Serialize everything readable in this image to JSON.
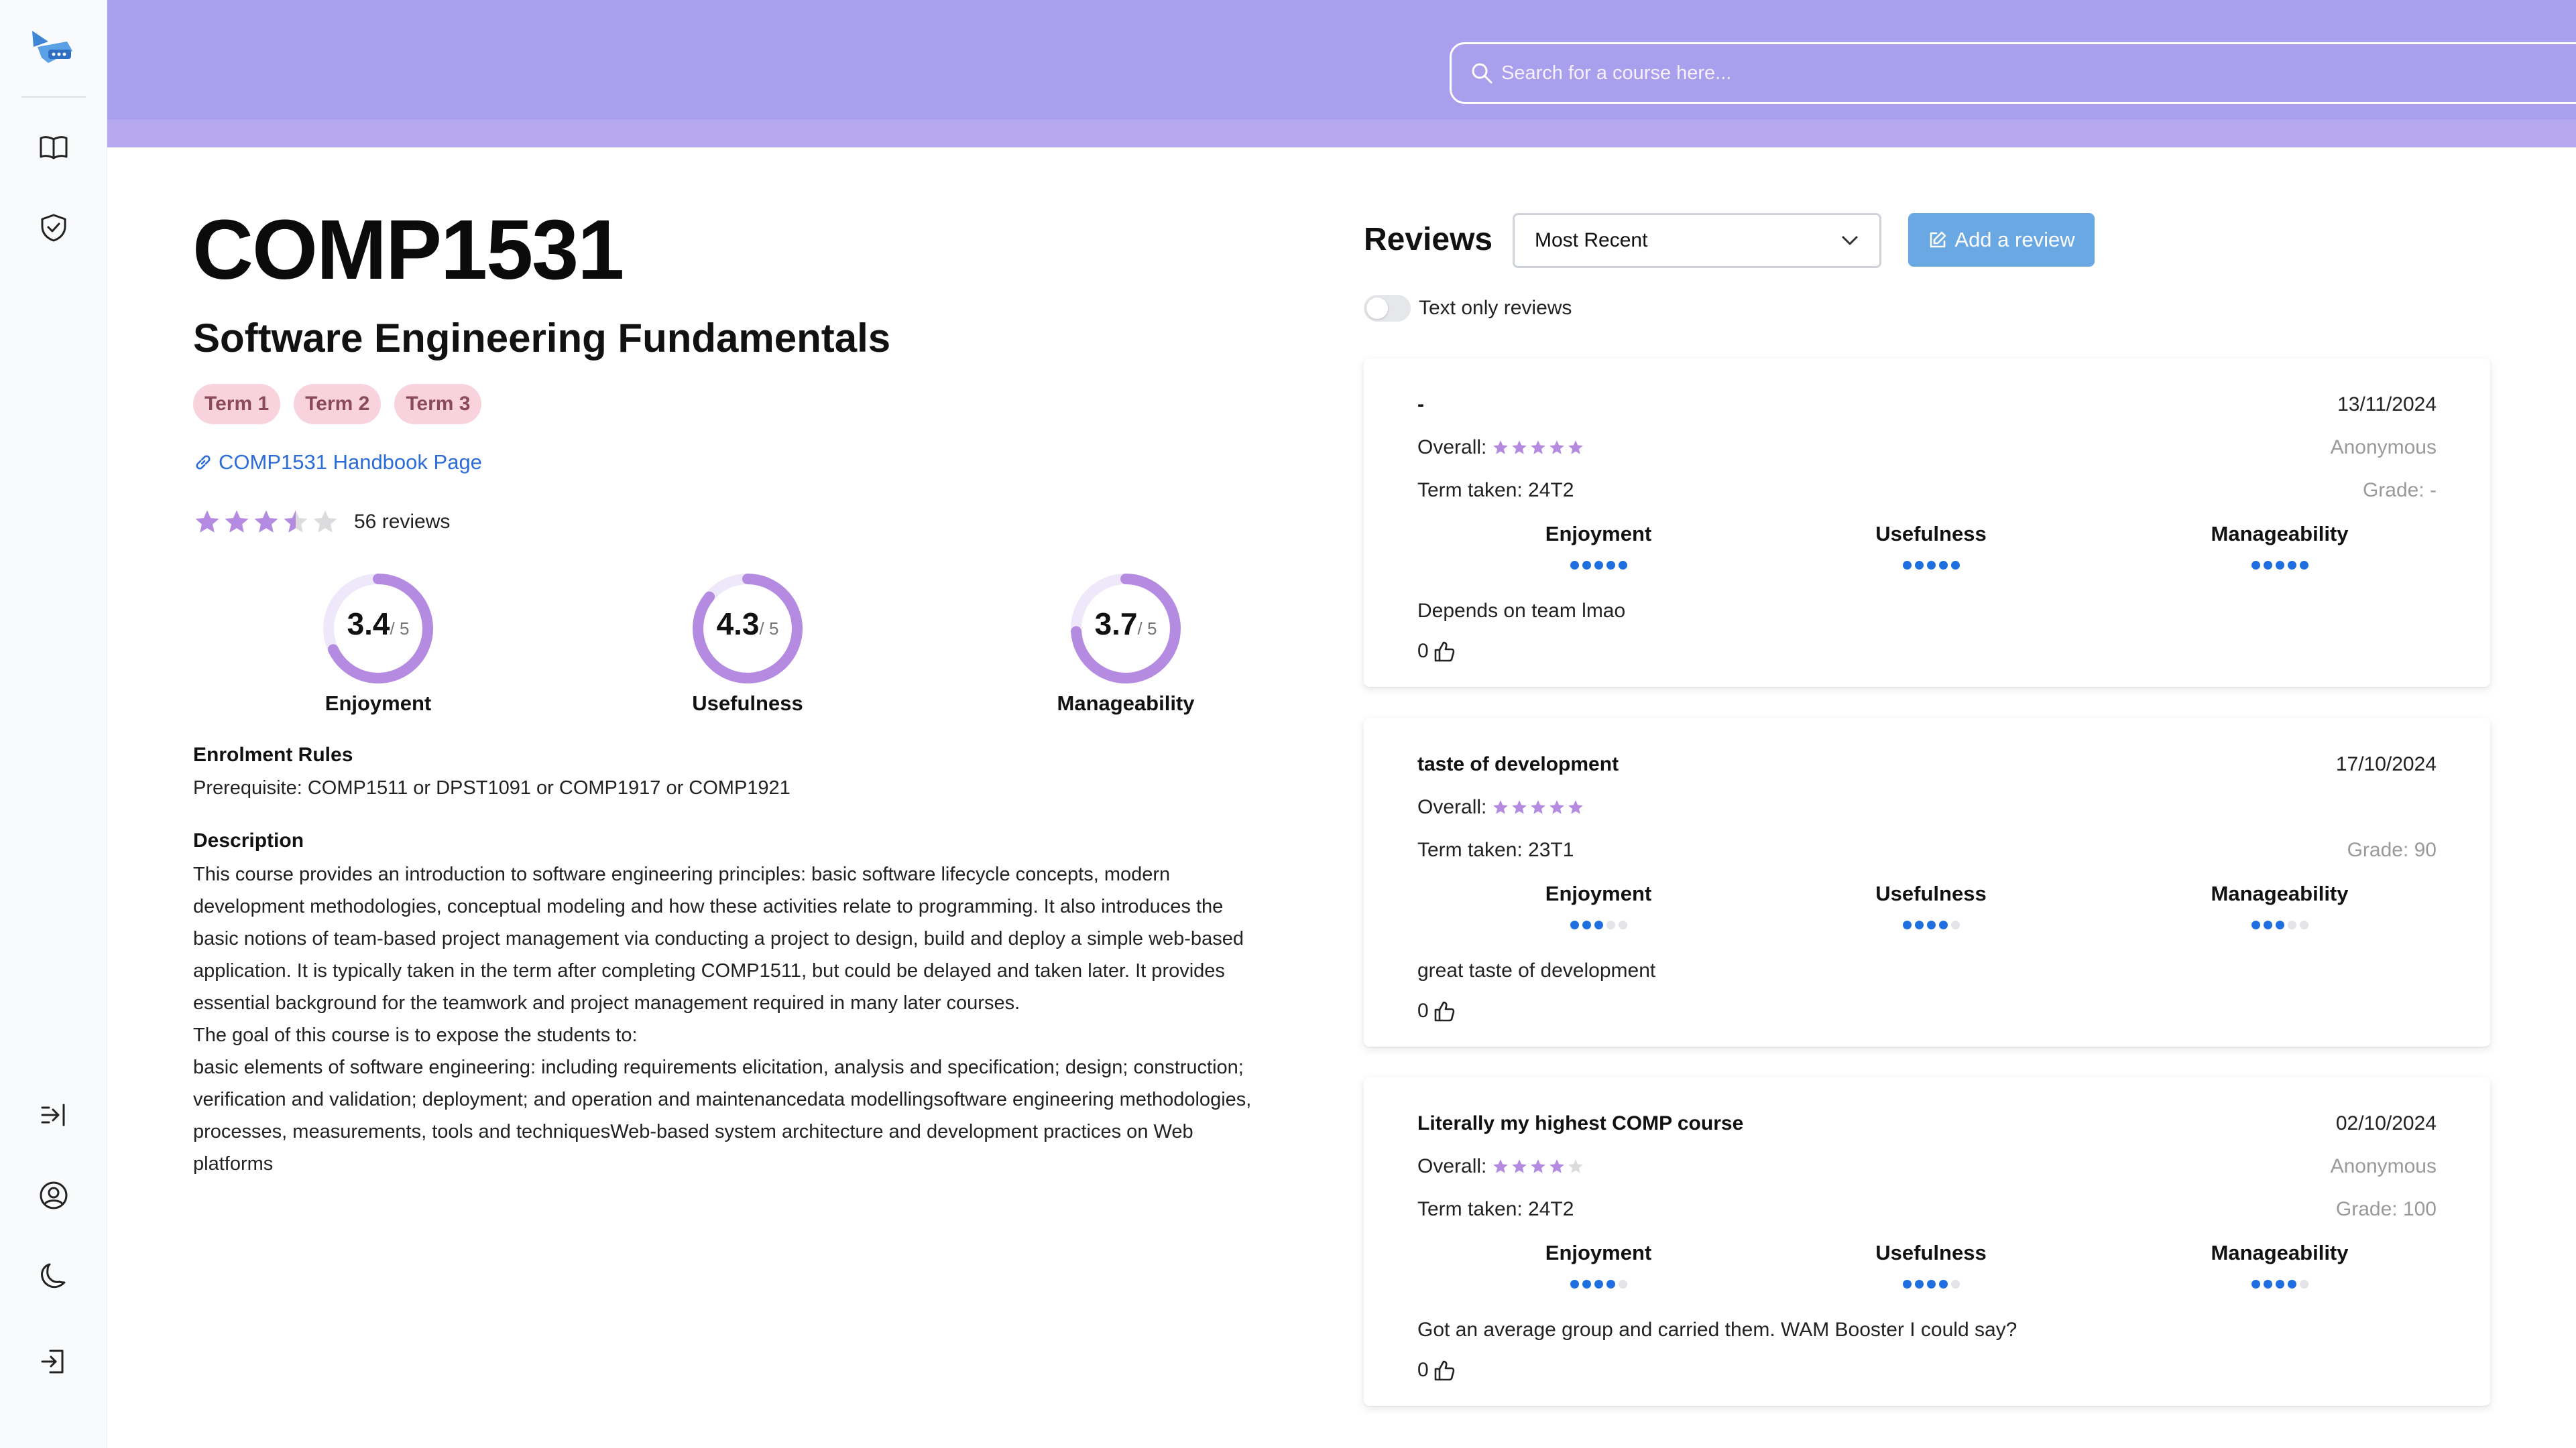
{
  "search": {
    "placeholder": "Search for a course here..."
  },
  "course": {
    "code": "COMP1531",
    "name": "Software Engineering Fundamentals",
    "terms": [
      "Term 1",
      "Term 2",
      "Term 3"
    ],
    "handbook_link": "COMP1531 Handbook Page",
    "overall_rating": 3.5,
    "overall_rating_max": 5,
    "reviews_count": "56 reviews",
    "stats": [
      {
        "value": "3.4",
        "max": "/ 5",
        "label": "Enjoyment",
        "fraction": 0.68
      },
      {
        "value": "4.3",
        "max": "/ 5",
        "label": "Usefulness",
        "fraction": 0.86
      },
      {
        "value": "3.7",
        "max": "/ 5",
        "label": "Manageability",
        "fraction": 0.74
      }
    ],
    "enrolment_title": "Enrolment Rules",
    "enrolment_text": "Prerequisite: COMP1511 or DPST1091 or COMP1917 or COMP1921",
    "description_title": "Description",
    "description_lines": [
      "This course provides an introduction to software engineering principles: basic software lifecycle concepts, modern",
      "development methodologies, conceptual modeling and how these activities relate to programming. It also introduces the",
      "basic notions of team-based project management via conducting a project to design, build and deploy a simple web-based",
      "application. It is typically taken in the term after completing COMP1511, but could be delayed and taken later. It provides",
      "essential background for the teamwork and project management required in many later courses.",
      "The goal of this course is to expose the students to:",
      "basic elements of software engineering: including requirements elicitation, analysis and specification; design; construction;",
      "verification and validation; deployment; and operation and maintenancedata modellingsoftware engineering methodologies,",
      "processes, measurements, tools and techniquesWeb-based system architecture and development practices on Web",
      "platforms"
    ]
  },
  "reviews_panel": {
    "title": "Reviews",
    "sort_selected": "Most Recent",
    "add_review_label": "Add a review",
    "text_only_label": "Text only reviews",
    "metric_labels": [
      "Enjoyment",
      "Usefulness",
      "Manageability"
    ],
    "overall_label": "Overall:",
    "reviews": [
      {
        "title": "-",
        "date": "13/11/2024",
        "overall": 5,
        "author": "Anonymous",
        "term_taken": "Term taken: 24T2",
        "grade": "Grade: -",
        "enjoyment": 5,
        "usefulness": 5,
        "manageability": 5,
        "body": "Depends on team lmao",
        "likes": "0"
      },
      {
        "title": "taste of development",
        "date": "17/10/2024",
        "overall": 5,
        "author": "",
        "term_taken": "Term taken: 23T1",
        "grade": "Grade: 90",
        "enjoyment": 3,
        "usefulness": 4,
        "manageability": 3,
        "body": "great taste of development",
        "likes": "0"
      },
      {
        "title": "Literally my highest COMP course",
        "date": "02/10/2024",
        "overall": 4,
        "author": "Anonymous",
        "term_taken": "Term taken: 24T2",
        "grade": "Grade: 100",
        "enjoyment": 4,
        "usefulness": 4,
        "manageability": 4,
        "body": "Got an average group and carried them. WAM Booster I could say?",
        "likes": "0"
      }
    ]
  },
  "colors": {
    "header": "#a99fec",
    "accent_purple": "#b48be0",
    "ring_purple": "#b48be0",
    "dot_blue": "#1f6fe0",
    "term_pill": "#f8d3de",
    "add_button": "#6aa8e4",
    "link_blue": "#2b6cd8"
  },
  "icons": {
    "sidebar": [
      "logo-icon",
      "book-icon",
      "shield-icon",
      "collapse-sidebar-icon",
      "user-circle-icon",
      "moon-icon",
      "login-icon"
    ]
  }
}
